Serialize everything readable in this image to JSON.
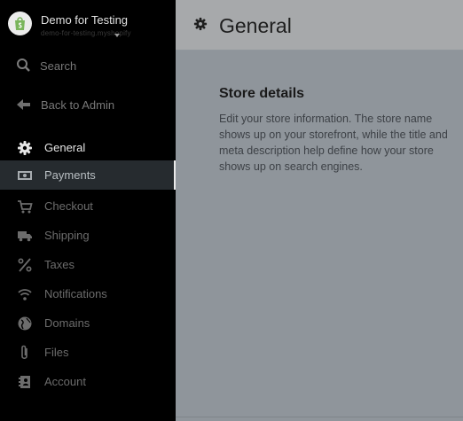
{
  "store": {
    "name": "Demo for Testing",
    "subtitle": "demo-for-testing.myshopify"
  },
  "sidebar": {
    "search_label": "Search",
    "back_label": "Back to Admin",
    "items": [
      {
        "label": "General",
        "icon": "gear-icon"
      },
      {
        "label": "Payments",
        "icon": "payments-icon"
      },
      {
        "label": "Checkout",
        "icon": "cart-icon"
      },
      {
        "label": "Shipping",
        "icon": "truck-icon"
      },
      {
        "label": "Taxes",
        "icon": "percent-icon"
      },
      {
        "label": "Notifications",
        "icon": "wifi-icon"
      },
      {
        "label": "Domains",
        "icon": "globe-icon"
      },
      {
        "label": "Files",
        "icon": "paperclip-icon"
      },
      {
        "label": "Account",
        "icon": "account-icon"
      }
    ],
    "selected_item": "Payments"
  },
  "main": {
    "title": "General",
    "section_title": "Store details",
    "section_desc": "Edit your store information. The store name shows up on your storefront, while the title and meta description help define how your store shows up on search engines."
  },
  "colors": {
    "sidebar_bg": "#000000",
    "selected_bg": "#262b2f",
    "main_bg": "#8f959b",
    "topbar_bg": "#a7a9ab"
  }
}
